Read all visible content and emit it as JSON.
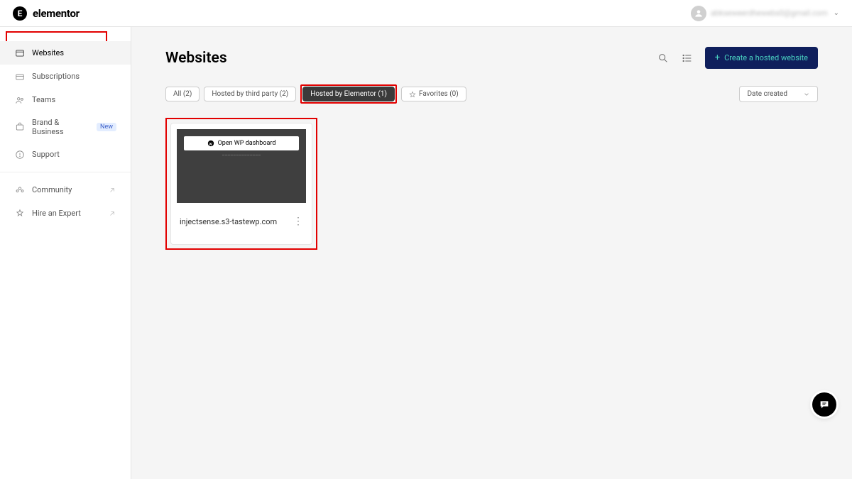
{
  "brand": {
    "name": "elementor",
    "logo_letter": "E"
  },
  "user": {
    "email_masked": "abkseweerdhewebs0@gmail.com"
  },
  "sidebar": {
    "group1": [
      {
        "label": "Websites",
        "icon": "websites",
        "active": true
      },
      {
        "label": "Subscriptions",
        "icon": "subscriptions"
      },
      {
        "label": "Teams",
        "icon": "teams"
      },
      {
        "label": "Brand & Business",
        "icon": "brand",
        "badge": "New"
      },
      {
        "label": "Support",
        "icon": "support"
      }
    ],
    "group2": [
      {
        "label": "Community",
        "icon": "community",
        "external": true
      },
      {
        "label": "Hire an Expert",
        "icon": "expert",
        "external": true
      }
    ]
  },
  "page": {
    "title": "Websites",
    "create_button": "Create a hosted website"
  },
  "filters": {
    "all": "All (2)",
    "third_party": "Hosted by third party (2)",
    "elementor": "Hosted by Elementor (1)",
    "favorites": "Favorites (0)",
    "sort": "Date created"
  },
  "site": {
    "wp_button": "Open WP dashboard",
    "url": "injectsense.s3-tastewp.com"
  }
}
